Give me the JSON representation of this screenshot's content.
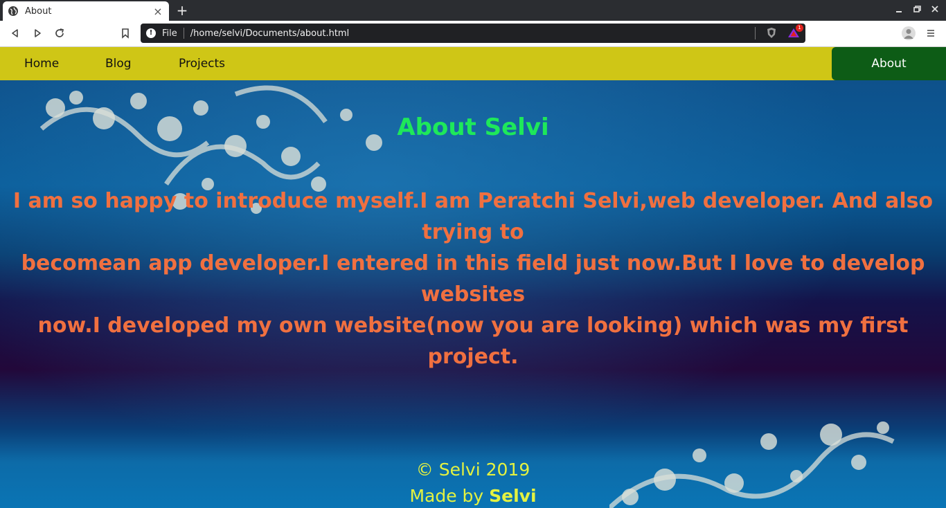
{
  "browser": {
    "tab_title": "About",
    "tab_close": "×",
    "new_tab": "+",
    "url_scheme": "File",
    "url_path": "/home/selvi/Documents/about.html",
    "rewards_count": "1",
    "icons": [
      "globe-icon",
      "back-icon",
      "forward-icon",
      "reload-icon",
      "bookmark-icon",
      "info-icon",
      "brave-shield-icon",
      "brave-rewards-icon",
      "profile-icon",
      "menu-icon",
      "minimize-icon",
      "restore-icon",
      "close-icon"
    ]
  },
  "nav": {
    "home": "Home",
    "blog": "Blog",
    "projects": "Projects",
    "about": "About"
  },
  "main": {
    "heading": "About Selvi",
    "intro_lines": [
      "I am so happy to introduce myself.I am Peratchi Selvi,web developer. And also trying to",
      "becomean app developer.I entered in this field just now.But I love to develop websites",
      "now.I developed my own website(now you are looking) which was my first project."
    ]
  },
  "footer": {
    "copyright": "© Selvi 2019",
    "made_by_prefix": "Made by",
    "made_by_name": "Selvi"
  },
  "colors": {
    "nav_bg": "#cfc616",
    "nav_active_bg": "#0d5c16",
    "heading": "#1ee85a",
    "intro_text": "#f07040",
    "footer_text": "#e4f240"
  }
}
